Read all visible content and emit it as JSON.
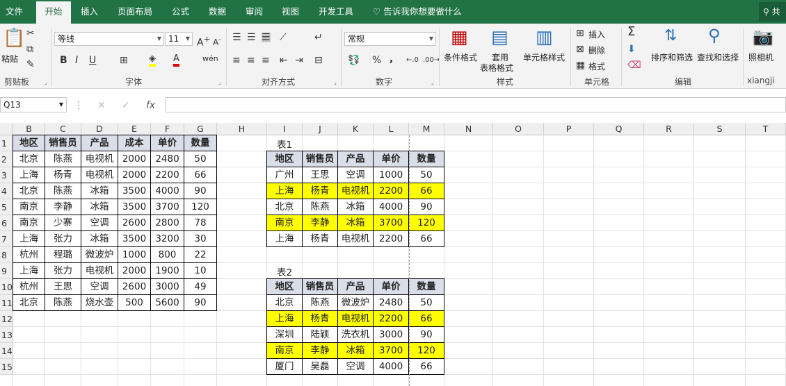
{
  "ribbon_tabs": [
    "文件",
    "开始",
    "插入",
    "页面布局",
    "公式",
    "数据",
    "审阅",
    "视图",
    "开发工具"
  ],
  "tell_me": "告诉我你想要做什么",
  "share": "共",
  "clipboard": {
    "paste": "粘贴",
    "group": "剪贴板"
  },
  "font": {
    "name": "等线",
    "size": "11",
    "group": "字体"
  },
  "alignment": {
    "group": "对齐方式"
  },
  "number": {
    "format": "常规",
    "percent": "%",
    "comma": ",",
    "group": "数字"
  },
  "styles": {
    "conditional": "条件格式",
    "table1": "套用",
    "table2": "表格格式",
    "cell_styles": "单元格样式",
    "group": "样式"
  },
  "cells": {
    "insert": "插入",
    "delete": "删除",
    "format": "格式",
    "group": "单元格"
  },
  "editing": {
    "sort": "排序和筛选",
    "find": "查找和选择",
    "group": "编辑"
  },
  "camera": {
    "label": "照相机",
    "group": "xiangji"
  },
  "name_box": "Q13",
  "columns": [
    "B",
    "C",
    "D",
    "E",
    "F",
    "G",
    "H",
    "I",
    "J",
    "K",
    "L",
    "M",
    "N",
    "O",
    "P",
    "Q",
    "R",
    "S",
    "T"
  ],
  "rows": [
    "1",
    "2",
    "3",
    "4",
    "5",
    "6",
    "7",
    "8",
    "9",
    "10",
    "11",
    "12",
    "13",
    "14",
    "15"
  ],
  "main_table": {
    "headers": [
      "地区",
      "销售员",
      "产品",
      "成本",
      "单价",
      "数量"
    ],
    "rows": [
      [
        "北京",
        "陈燕",
        "电视机",
        "2000",
        "2480",
        "50"
      ],
      [
        "上海",
        "杨青",
        "电视机",
        "2000",
        "2200",
        "66"
      ],
      [
        "北京",
        "陈燕",
        "冰箱",
        "3500",
        "4000",
        "90"
      ],
      [
        "南京",
        "李静",
        "冰箱",
        "3500",
        "3700",
        "120"
      ],
      [
        "南京",
        "少寨",
        "空调",
        "2600",
        "2800",
        "78"
      ],
      [
        "上海",
        "张力",
        "冰箱",
        "3500",
        "3200",
        "30"
      ],
      [
        "杭州",
        "程璐",
        "微波炉",
        "1000",
        "800",
        "22"
      ],
      [
        "上海",
        "张力",
        "电视机",
        "2000",
        "1900",
        "10"
      ],
      [
        "杭州",
        "王思",
        "空调",
        "2600",
        "3000",
        "49"
      ],
      [
        "北京",
        "陈燕",
        "烧水壶",
        "500",
        "5600",
        "90"
      ]
    ]
  },
  "table1": {
    "caption": "表1",
    "headers": [
      "地区",
      "销售员",
      "产品",
      "单价",
      "数量"
    ],
    "rows": [
      [
        "广州",
        "王思",
        "空调",
        "1000",
        "50"
      ],
      [
        "上海",
        "杨青",
        "电视机",
        "2200",
        "66"
      ],
      [
        "北京",
        "陈燕",
        "冰箱",
        "4000",
        "90"
      ],
      [
        "南京",
        "李静",
        "冰箱",
        "3700",
        "120"
      ],
      [
        "上海",
        "杨青",
        "电视机",
        "2200",
        "66"
      ]
    ],
    "highlight": [
      1,
      3
    ]
  },
  "table2": {
    "caption": "表2",
    "headers": [
      "地区",
      "销售员",
      "产品",
      "单价",
      "数量"
    ],
    "rows": [
      [
        "北京",
        "陈燕",
        "微波炉",
        "2480",
        "50"
      ],
      [
        "上海",
        "杨青",
        "电视机",
        "2200",
        "66"
      ],
      [
        "深圳",
        "陆颖",
        "洗衣机",
        "3000",
        "90"
      ],
      [
        "南京",
        "李静",
        "冰箱",
        "3700",
        "120"
      ],
      [
        "厦门",
        "吴磊",
        "空调",
        "4000",
        "66"
      ]
    ],
    "highlight": [
      1,
      3
    ]
  },
  "colors": {
    "excel_green": "#217346",
    "highlight": "#ffff00",
    "header_fill": "#d9dee8"
  }
}
